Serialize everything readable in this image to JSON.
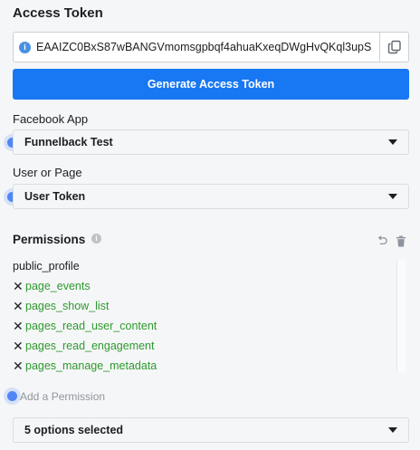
{
  "access_token": {
    "title": "Access Token",
    "value": "EAAIZC0BxS87wBANGVmomsgpbqf4ahuaKxeqDWgHvQKql3upS",
    "generate_label": "Generate Access Token"
  },
  "facebook_app": {
    "label": "Facebook App",
    "selected": "Funnelback Test"
  },
  "user_or_page": {
    "label": "User or Page",
    "selected": "User Token"
  },
  "permissions": {
    "title": "Permissions",
    "items": [
      {
        "name": "public_profile",
        "removable": false
      },
      {
        "name": "page_events",
        "removable": true
      },
      {
        "name": "pages_show_list",
        "removable": true
      },
      {
        "name": "pages_read_user_content",
        "removable": true
      },
      {
        "name": "pages_read_engagement",
        "removable": true
      },
      {
        "name": "pages_manage_metadata",
        "removable": true
      }
    ],
    "add_placeholder": "Add a Permission",
    "options_selected": "5 options selected"
  },
  "colors": {
    "primary": "#1877f2",
    "permission_green": "#2e9a2e",
    "dot_blue": "#4f86f7"
  },
  "icons": {
    "info": "info-icon",
    "copy": "copy-icon",
    "undo": "undo-icon",
    "trash": "trash-icon",
    "remove": "x-icon",
    "dropdown": "caret-down-icon"
  }
}
